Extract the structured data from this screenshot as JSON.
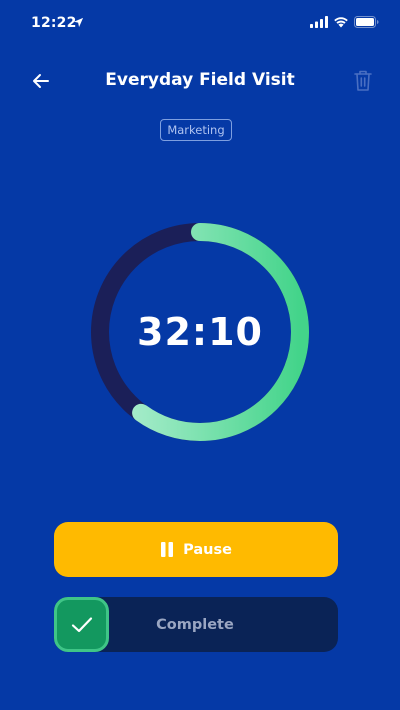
{
  "status_bar": {
    "time": "12:22",
    "icons": [
      "location-arrow-icon",
      "cellular-signal-icon",
      "wifi-icon",
      "battery-icon"
    ]
  },
  "header": {
    "title": "Everyday Field Visit",
    "back_icon": "arrow-left-icon",
    "delete_icon": "trash-icon"
  },
  "tag": {
    "label": "Marketing"
  },
  "timer": {
    "display": "32:10",
    "progress_fraction": 0.6,
    "colors": {
      "track": "#1B1F58",
      "progress_start": "#B8F0D6",
      "progress_end": "#43D48A"
    }
  },
  "actions": {
    "pause_label": "Pause",
    "pause_icon": "pause-icon",
    "complete_label": "Complete",
    "complete_icon": "check-icon"
  },
  "colors": {
    "background": "#0539A6",
    "pause_button": "#FFBA00",
    "complete_track": "#0A2356",
    "complete_knob": "#13985F"
  }
}
